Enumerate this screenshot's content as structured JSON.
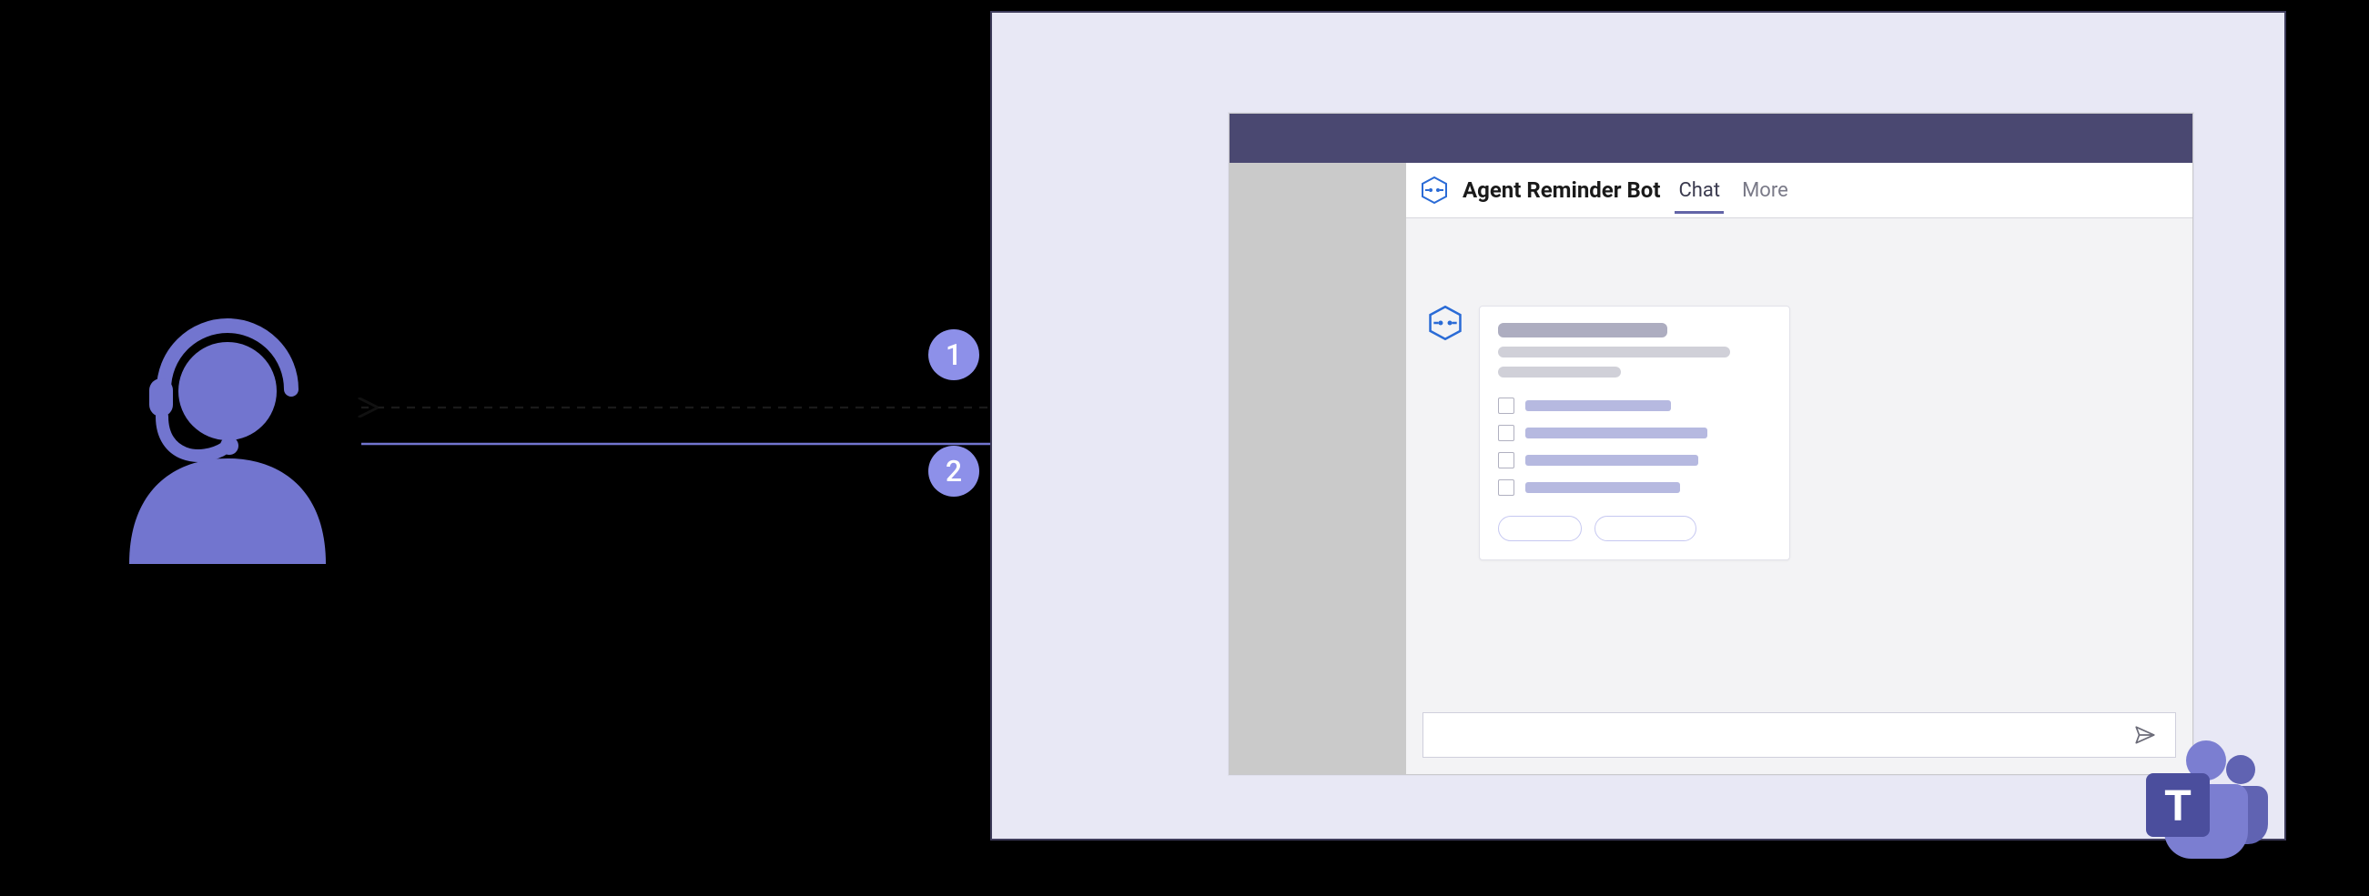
{
  "agent": {
    "label": "support-agent"
  },
  "steps": {
    "one": "1",
    "two": "2"
  },
  "bot": {
    "label": "bot-framework"
  },
  "teams": {
    "app_name": "Agent Reminder Bot",
    "tabs": {
      "chat": "Chat",
      "more": "More",
      "active": "chat"
    },
    "compose": {
      "placeholder": ""
    },
    "logo_letter": "T"
  }
}
